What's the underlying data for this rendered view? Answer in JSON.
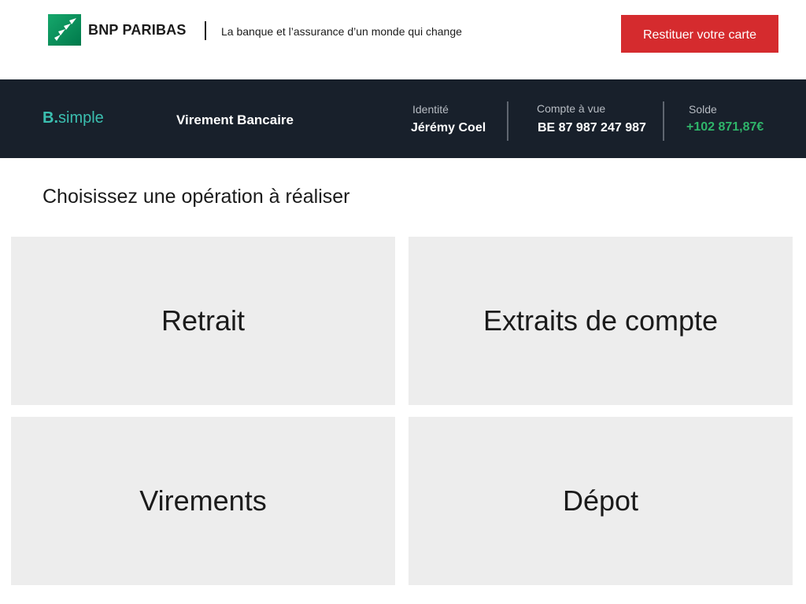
{
  "header": {
    "brand_name": "BNP PARIBAS",
    "tagline": "La banque et l’assurance d’un monde qui change",
    "return_card_label": "Restituer votre carte",
    "accent_color": "#d52b2e",
    "logo_color": "#00915a"
  },
  "account_bar": {
    "app_logo_b": "B",
    "app_logo_dot": ".",
    "app_logo_word": "simple",
    "section_title": "Virement Bancaire",
    "identity_label": "Identité",
    "identity_value": "Jérémy Coel",
    "account_label": "Compte à vue",
    "account_value": "BE 87 987 247 987",
    "balance_label": "Solde",
    "balance_value": "+102 871,87€",
    "background_color": "#18202b",
    "balance_color": "#2fb56a"
  },
  "main": {
    "title": "Choisissez une opération à réaliser",
    "tiles": [
      {
        "label": "Retrait"
      },
      {
        "label": "Extraits de compte"
      },
      {
        "label": "Virements"
      },
      {
        "label": "Dépot"
      }
    ]
  }
}
